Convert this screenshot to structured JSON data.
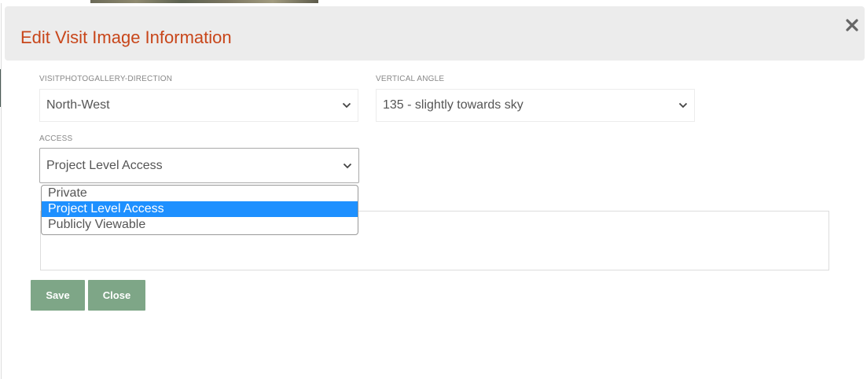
{
  "modal": {
    "title": "Edit Visit Image Information"
  },
  "fields": {
    "direction": {
      "label": "VISITPHOTOGALLERY-DIRECTION",
      "value": "North-West"
    },
    "vertical_angle": {
      "label": "VERTICAL ANGLE",
      "value": "135 - slightly towards sky"
    },
    "access": {
      "label": "ACCESS",
      "value": "Project Level Access",
      "options": [
        "Private",
        "Project Level Access",
        "Publicly Viewable"
      ],
      "selected_index": 1
    }
  },
  "buttons": {
    "save": "Save",
    "close": "Close"
  },
  "colors": {
    "title": "#c8461a",
    "button_bg": "#7ea687",
    "option_highlight": "#1e90ff"
  }
}
